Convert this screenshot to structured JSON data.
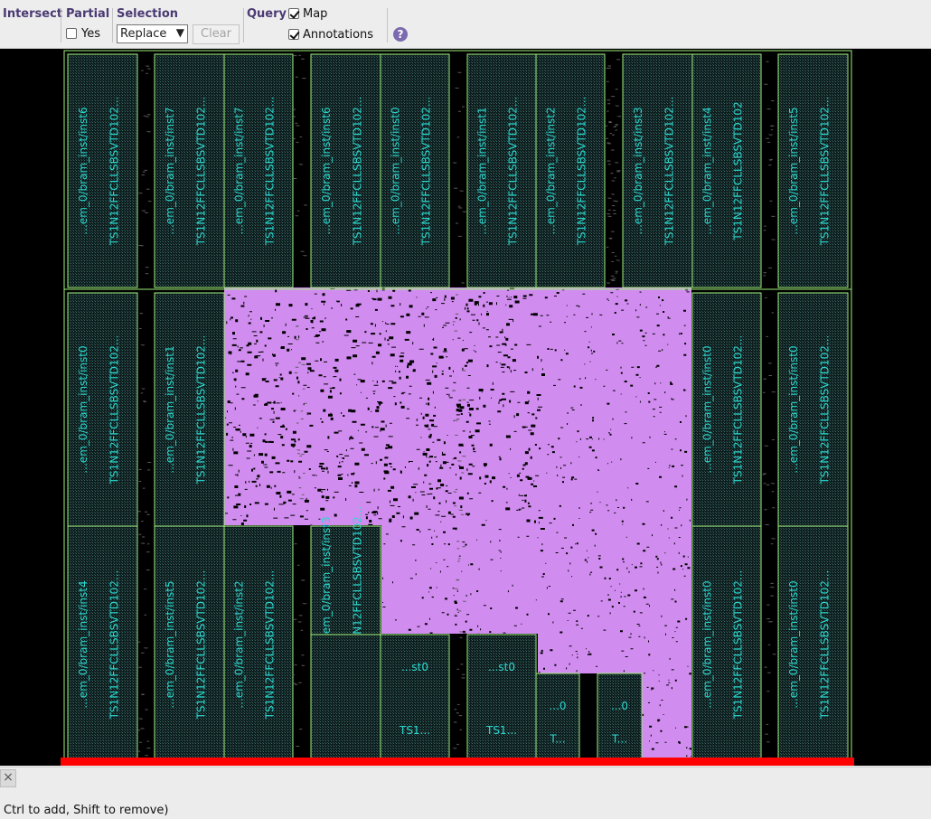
{
  "toolbar": {
    "intersect_label": "Intersect",
    "partial_label": "Partial",
    "partial_yes_label": "Yes",
    "partial_yes_checked": false,
    "selection_label": "Selection",
    "selection_value": "Replace",
    "clear_label": "Clear",
    "query_label": "Query",
    "map_label": "Map",
    "map_checked": true,
    "annotations_label": "Annotations",
    "annotations_checked": true,
    "help_icon": "?"
  },
  "layout": {
    "colors": {
      "background": "#000000",
      "cell_outline": "#9ef07a",
      "cell_label": "#2ad8d0",
      "routing_fill": "#d18cf0",
      "die_edge": "#ff0000"
    },
    "cells": [
      {
        "name": "...em_0/bram_inst/inst6",
        "type": "TS1N12FFCLLSBSVTD102..."
      },
      {
        "name": "...em_0/bram_inst/inst7",
        "type": "TS1N12FFCLLSBSVTD102..."
      },
      {
        "name": "...em_0/bram_inst/inst7",
        "type": "TS1N12FFCLLSBSVTD102..."
      },
      {
        "name": "...em_0/bram_inst/inst6",
        "type": "TS1N12FFCLLSBSVTD102..."
      },
      {
        "name": "...em_0/bram_inst/inst0",
        "type": "TS1N12FFCLLSBSVTD102..."
      },
      {
        "name": "...em_0/bram_inst/inst1",
        "type": "TS1N12FFCLLSBSVTD102..."
      },
      {
        "name": "...em_0/bram_inst/inst2",
        "type": "TS1N12FFCLLSBSVTD102..."
      },
      {
        "name": "...em_0/bram_inst/inst3",
        "type": "TS1N12FFCLLSBSVTD102..."
      },
      {
        "name": "...em_0/bram_inst/inst4",
        "type": "TS1N12FFCLLSBSVTD102"
      },
      {
        "name": "...em_0/bram_inst/inst5",
        "type": "TS1N12FFCLLSBSVTD102..."
      },
      {
        "name": "...em_0/bram_inst/inst0",
        "type": "TS1N12FFCLLSBSVTD102..."
      },
      {
        "name": "...em_0/bram_inst/inst1",
        "type": "TS1N12FFCLLSBSVTD102..."
      },
      {
        "name": "...em_0/bram_inst/inst0",
        "type": "TS1N12FFCLLSBSVTD102..."
      },
      {
        "name": "...em_0/bram_inst/inst0",
        "type": "TS1N12FFCLLSBSVTD102..."
      },
      {
        "name": "...em_0/bram_inst/inst4",
        "type": "TS1N12FFCLLSBSVTD102..."
      },
      {
        "name": "...em_0/bram_inst/inst5",
        "type": "TS1N12FFCLLSBSVTD102..."
      },
      {
        "name": "...em_0/bram_inst/inst2",
        "type": "TS1N12FFCLLSBSVTD102..."
      },
      {
        "name": "...em_0/bram_inst/inst3",
        "type": "TS1N12FFCLLSBSVTD102..."
      },
      {
        "name": "...em_0/bram_inst/inst0",
        "type": "TS1N12FFCLLSBSVTD102..."
      },
      {
        "name": "...em_0/bram_inst/inst0",
        "type": "TS1N12FFCLLSBSVTD102..."
      }
    ],
    "small_cells": [
      {
        "name": "...st0",
        "type": "TS1..."
      },
      {
        "name": "...st0",
        "type": "TS1..."
      },
      {
        "name": "...0",
        "type": "T..."
      },
      {
        "name": "...0",
        "type": "T..."
      }
    ]
  },
  "status": {
    "close_icon": "×",
    "hint": "Ctrl to add, Shift to remove)"
  }
}
